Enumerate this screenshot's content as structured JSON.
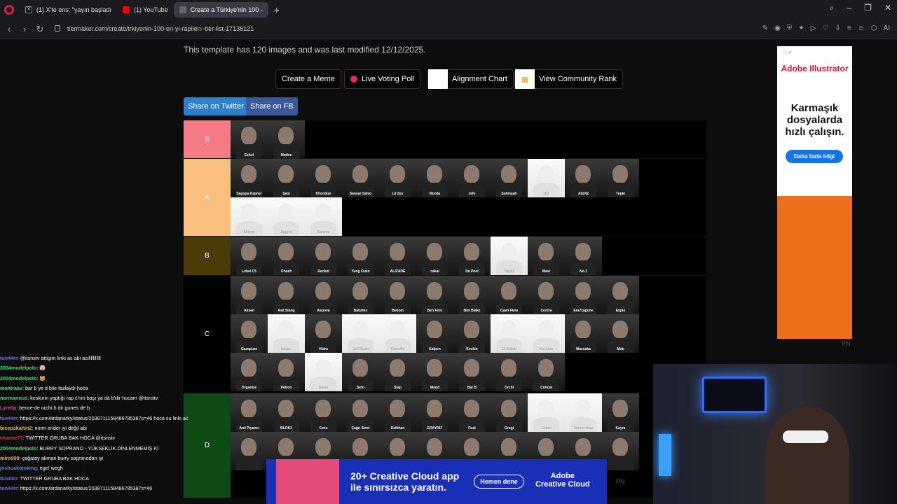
{
  "browser": {
    "tabs": [
      {
        "label": "(1) X'te ens: \"yayın başladı"
      },
      {
        "label": "(1) YouTube"
      },
      {
        "label": "Create a Türkiye'nin 100 -"
      }
    ],
    "url": "tiermaker.com/create/trkiyenin-100-en-yi-rapileri--tier-list-17136121",
    "ai_label": "AI"
  },
  "page": {
    "info": "This template has 120 images and was last modified 12/12/2025.",
    "buttons": {
      "meme": "Create a Meme",
      "voting": "Live Voting Poll",
      "alignment": "Alignment Chart",
      "community": "View Community Rank",
      "twitter": "Share on Twitter",
      "fb": "Share on FB"
    }
  },
  "tiers": [
    {
      "label": "S",
      "color": "#f47b84",
      "items": [
        "Ezhel",
        "Motive"
      ]
    },
    {
      "label": "A",
      "color": "#f8bf7f",
      "items": [
        "Sagopa Kajmer",
        "Şam",
        "Khontkar",
        "Sansar Salvo",
        "Lil Zey",
        "Murda",
        "Jefe",
        "Şehinşah",
        "UZI",
        "Ati242",
        "Tepki",
        "Allâme",
        "Jagged",
        "Baneva"
      ]
    },
    {
      "label": "B",
      "color": "#4a3b09",
      "items": [
        "Lvbel C5",
        "Ohash",
        "Reckol",
        "Yung Ouzo",
        "ALIZADE",
        "cakal",
        "Da Poet",
        "Hayki",
        "Mavi",
        "No.1"
      ]
    },
    {
      "label": "C",
      "color": "#000000",
      "items": [
        "Aksan",
        "Asil Slang",
        "Aspova",
        "Batuflex",
        "Bekom",
        "Ben Fero",
        "Bixi Blake",
        "Cash Flow",
        "Contra",
        "Era7capone",
        "Eypio",
        "Gazapizm",
        "Heijan",
        "Hidra",
        "Jeff Redd",
        "Kamufle",
        "Kalpen",
        "Keskin",
        "13 Killoki",
        "Kozmos",
        "Massaka",
        "Mutı",
        "Organize",
        "Patron",
        "Saian",
        "Sefo",
        "Stap",
        "Modd",
        "Bar B",
        "Orchi",
        "Critical"
      ]
    },
    {
      "label": "D",
      "color": "#0d4a14",
      "items": [
        "Anıl Piyancı",
        "BLOK3",
        "Ceza",
        "Çağrı Sinci",
        "Defkhan",
        "ERAY067",
        "Fuat",
        "Grogi",
        "Joker",
        "Server Uraz",
        "Kayra",
        "",
        "",
        "",
        "",
        "",
        "",
        "",
        "",
        "",
        "",
        ""
      ]
    }
  ],
  "light_items": [
    "UZI",
    "Allâme",
    "Jagged",
    "Baneva",
    "Hayki",
    "Heijan",
    "Jeff Redd",
    "Kamufle",
    "13 Killoki",
    "Kozmos",
    "Saian",
    "Joker",
    "Server Uraz"
  ],
  "ad_right": {
    "brand": "Adobe Illustrator",
    "headline": "Karmaşık dosyalarda hızlı çalışın.",
    "cta": "Daha fazla bilgi",
    "pn": "PN"
  },
  "chat": [
    {
      "user": "tun44rr",
      "user_color": "#7a6cff",
      "msg": ": @itsnstv attigim linki ac abi acilllllllllll"
    },
    {
      "user": "2004modelpolo",
      "user_color": "#3fe07a",
      "msg": ": 🤡"
    },
    {
      "user": "2004modelpolo",
      "user_color": "#3fe07a",
      "msg": ": 🐱"
    },
    {
      "user": "mantraav",
      "user_color": "#3fe07a",
      "msg": ": bar b ye d bile fazlaydı hoca"
    },
    {
      "user": "normannus",
      "user_color": "#3fe07a",
      "msg": ": keskinin yaptığı rap c'nin başı ya da b'dir hocam @itsnstv"
    },
    {
      "user": "Lyre0p",
      "user_color": "#d84b8c",
      "msg": ": bence de orchi b dir gunes de b"
    },
    {
      "user": "tun44rr",
      "user_color": "#7a6cff",
      "msg": ": https://x.com/ardanarky/status/2038711158486785387s=46 hoca su linki ac"
    },
    {
      "user": "bicepskahin2",
      "user_color": "#e6b24a",
      "msg": ": norm ender iyi değil abi"
    },
    {
      "user": "ekanne77",
      "user_color": "#e03434",
      "msg": ": TWİTTER GRUBA BAK HOCA @itsnstv"
    },
    {
      "user": "2004modelpolo",
      "user_color": "#3fe07a",
      "msg": ": BURRY SOPRANO - YÜKSEKLİK DİNLENMEMİŞ Kİ"
    },
    {
      "user": "miro999",
      "user_color": "#e6b24a",
      "msg": ": çağatay akman burry sopranodan iyi"
    },
    {
      "user": "joshuakojoking",
      "user_color": "#4a8ce6",
      "msg": ": ege! wegh"
    },
    {
      "user": "tun44rr",
      "user_color": "#7a6cff",
      "msg": ": TWITTER GRUBA BAK HOCA"
    },
    {
      "user": "tun44rr",
      "user_color": "#7a6cff",
      "msg": ": https://x.com/ardanarky/status/2038711158486785387s=46"
    }
  ],
  "bottom_ad": {
    "headline_1": "20+ Creative Cloud app",
    "headline_2": "ile sınırsızca yaratın.",
    "cta": "Hemen dene",
    "brand_1": "Adobe",
    "brand_2": "Creative Cloud",
    "pn": "PN"
  }
}
